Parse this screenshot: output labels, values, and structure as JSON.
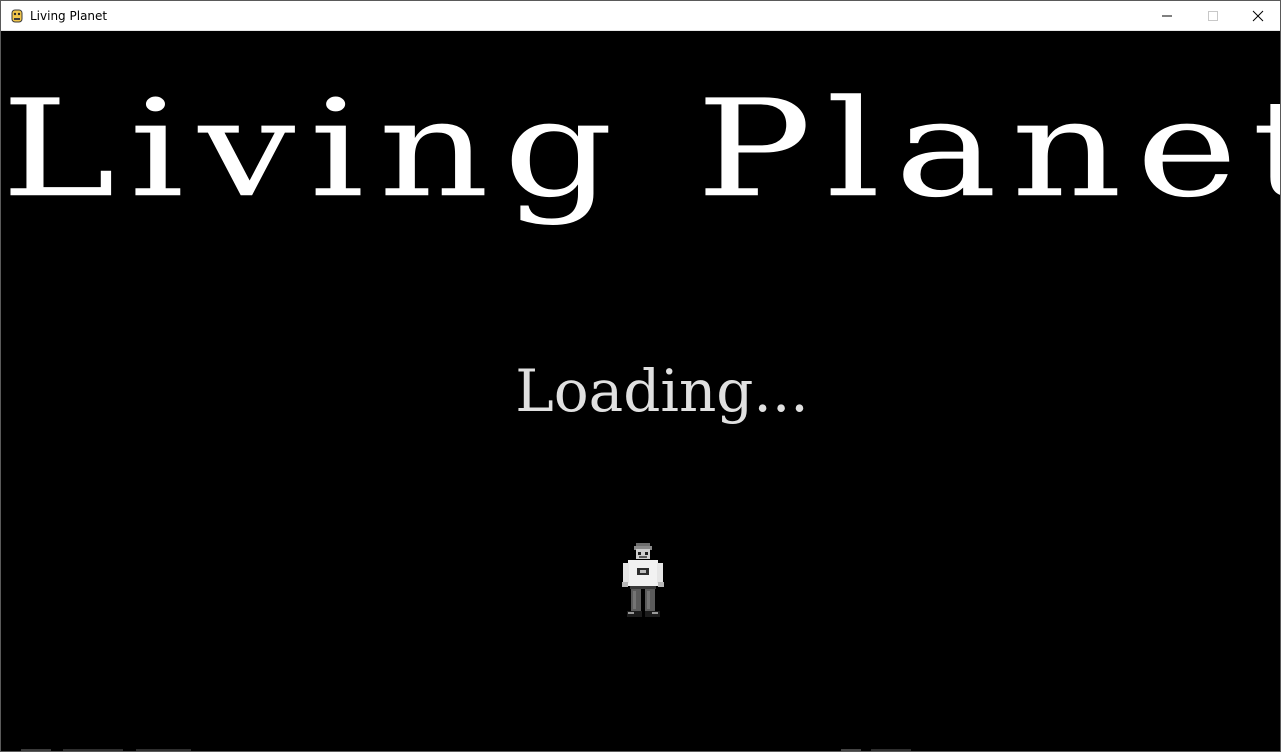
{
  "window": {
    "title": "Living Planet",
    "app_icon": "pygame-snake-icon",
    "controls": [
      "minimize-icon",
      "maximize-icon",
      "close-icon"
    ]
  },
  "game": {
    "title": "Living Planet",
    "status": "Loading..."
  },
  "colors": {
    "background": "#000000",
    "title_text": "#ffffff",
    "loading_text": "#e0e0e0"
  }
}
